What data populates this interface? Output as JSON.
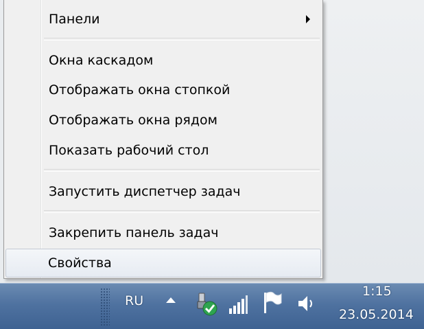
{
  "context_menu": {
    "items": [
      {
        "label": "Панели",
        "has_submenu": true
      },
      {
        "label": "Окна каскадом"
      },
      {
        "label": "Отображать окна стопкой"
      },
      {
        "label": "Отображать окна рядом"
      },
      {
        "label": "Показать рабочий стол"
      },
      {
        "label": "Запустить диспетчер задач"
      },
      {
        "label": "Закрепить панель задач"
      },
      {
        "label": "Свойства",
        "highlighted": true
      }
    ]
  },
  "taskbar": {
    "language": "RU",
    "tray_icons": [
      "show-hidden-icons-arrow",
      "usb-safely-remove-icon",
      "signal-bars-icon",
      "action-center-flag-icon",
      "volume-icon"
    ],
    "clock_time": "1:15",
    "clock_date": "23.05.2014"
  },
  "colors": {
    "menu_bg": "#f0f0f0",
    "taskbar": "#4f72a0",
    "highlight_border": "#c3cad4"
  }
}
